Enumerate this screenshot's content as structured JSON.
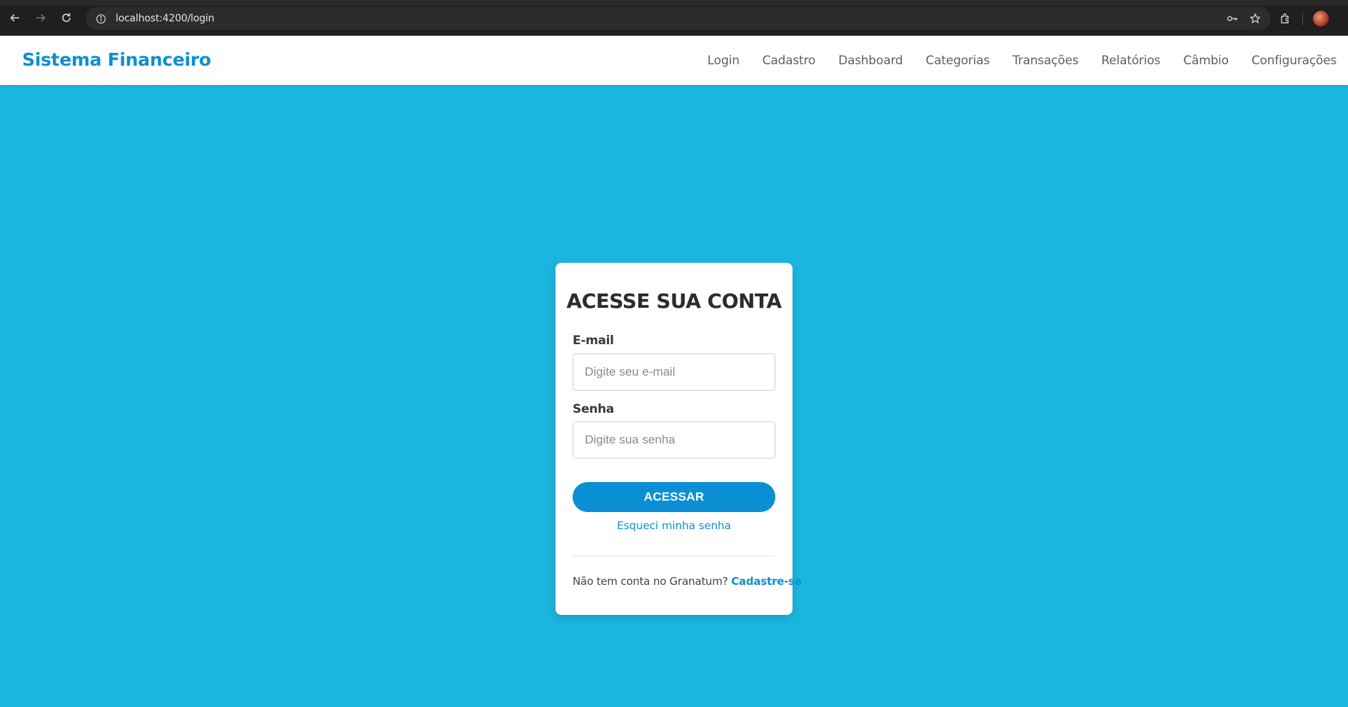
{
  "browser": {
    "url": "localhost:4200/login"
  },
  "app": {
    "brand": "Sistema Financeiro",
    "nav": [
      {
        "label": "Login"
      },
      {
        "label": "Cadastro"
      },
      {
        "label": "Dashboard"
      },
      {
        "label": "Categorias"
      },
      {
        "label": "Transações"
      },
      {
        "label": "Relatórios"
      },
      {
        "label": "Câmbio"
      },
      {
        "label": "Configurações"
      }
    ]
  },
  "login": {
    "title": "ACESSE SUA CONTA",
    "email_label": "E-mail",
    "email_placeholder": "Digite seu e-mail",
    "password_label": "Senha",
    "password_placeholder": "Digite sua senha",
    "submit_label": "ACESSAR",
    "forgot_label": "Esqueci minha senha",
    "no_account_text": "Não tem conta no Granatum?",
    "signup_label": "Cadastre-se"
  },
  "colors": {
    "background": "#1bb6df",
    "accent": "#0a8fd4",
    "brand": "#0f8fcf"
  }
}
